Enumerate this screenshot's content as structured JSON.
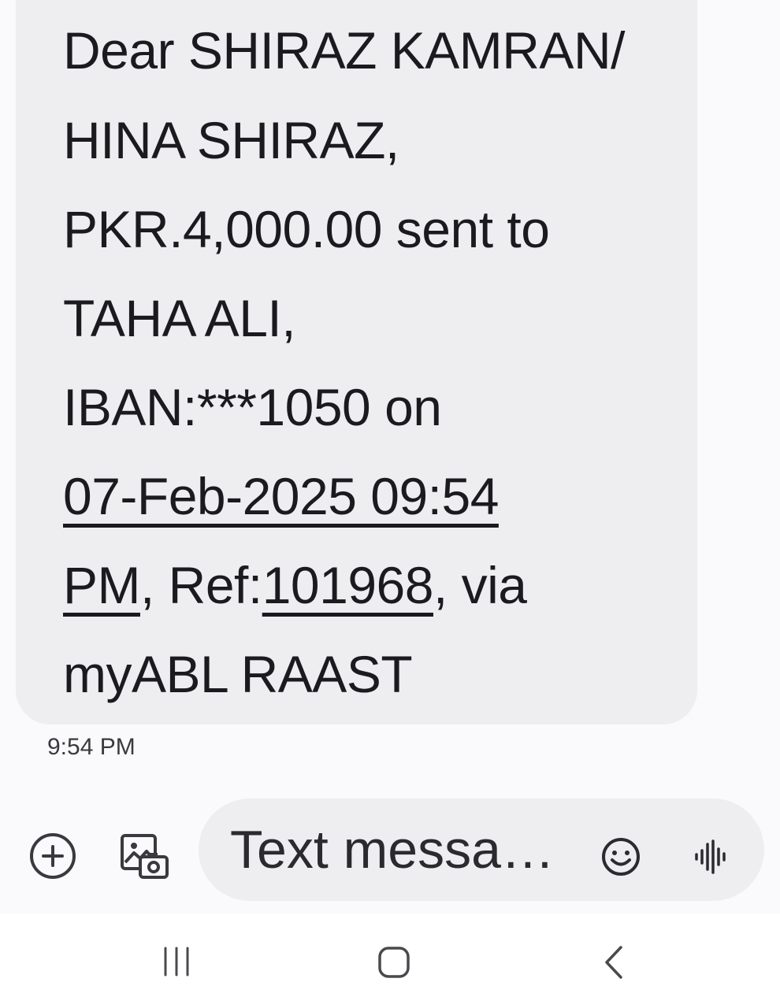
{
  "message": {
    "lines": [
      [
        {
          "text": "Dear SHIRAZ KAMRAN/"
        }
      ],
      [
        {
          "text": "HINA SHIRAZ,"
        }
      ],
      [
        {
          "text": "PKR.4,000.00 sent to"
        }
      ],
      [
        {
          "text": "TAHA ALI,"
        }
      ],
      [
        {
          "text": "IBAN:***1050 on"
        }
      ],
      [
        {
          "text": "07-Feb-2025 09:54",
          "link": true
        }
      ],
      [
        {
          "text": "PM",
          "link": true
        },
        {
          "text": ", Ref:"
        },
        {
          "text": "101968",
          "link": true
        },
        {
          "text": ", via"
        }
      ],
      [
        {
          "text": "myABL RAAST"
        }
      ]
    ],
    "timestamp": "9:54 PM"
  },
  "compose": {
    "placeholder": "Text messa…",
    "icons": {
      "add": "add-circle-icon",
      "gallery": "gallery-camera-icon",
      "emoji": "emoji-smile-icon",
      "voice": "voice-waveform-icon"
    }
  },
  "nav": {
    "icons": [
      "recent-apps-icon",
      "home-icon",
      "back-icon"
    ]
  },
  "colors": {
    "bubble": "#eeeef0",
    "background": "#fafafc",
    "text": "#1b1b1f",
    "icon": "#3a3a3e"
  }
}
